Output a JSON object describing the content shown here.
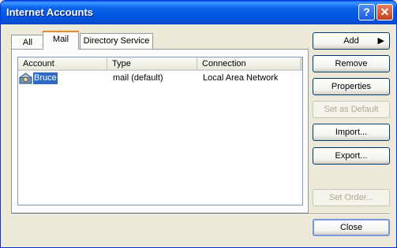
{
  "window": {
    "title": "Internet Accounts"
  },
  "tabs": [
    {
      "label": "All"
    },
    {
      "label": "Mail"
    },
    {
      "label": "Directory Service"
    }
  ],
  "list": {
    "columns": [
      "Account",
      "Type",
      "Connection"
    ],
    "rows": [
      {
        "account": "Bruce",
        "type": "mail (default)",
        "connection": "Local Area Network",
        "icon": "mail-account-icon"
      }
    ]
  },
  "buttons": {
    "add": "Add",
    "remove": "Remove",
    "properties": "Properties",
    "set_default": "Set as Default",
    "import": "Import...",
    "export": "Export...",
    "set_order": "Set Order...",
    "close": "Close"
  },
  "colors": {
    "titlebar": "#0053e1",
    "selection": "#316ac5"
  }
}
